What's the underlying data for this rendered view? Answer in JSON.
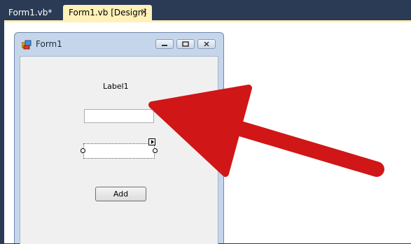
{
  "tabs": [
    {
      "label": "Form1.vb*"
    },
    {
      "label": "Form1.vb [Design]",
      "close_icon": "×"
    }
  ],
  "form": {
    "title": "Form1",
    "label1": "Label1",
    "textbox1_value": "",
    "textbox2_value": "",
    "add_button_label": "Add"
  },
  "annotation": {
    "arrow_color": "#d01616",
    "points_to": "textbox2"
  },
  "colors": {
    "tab_active": "#fff1b8",
    "ide_background": "#2b3a55",
    "form_client": "#f0f0f0"
  }
}
